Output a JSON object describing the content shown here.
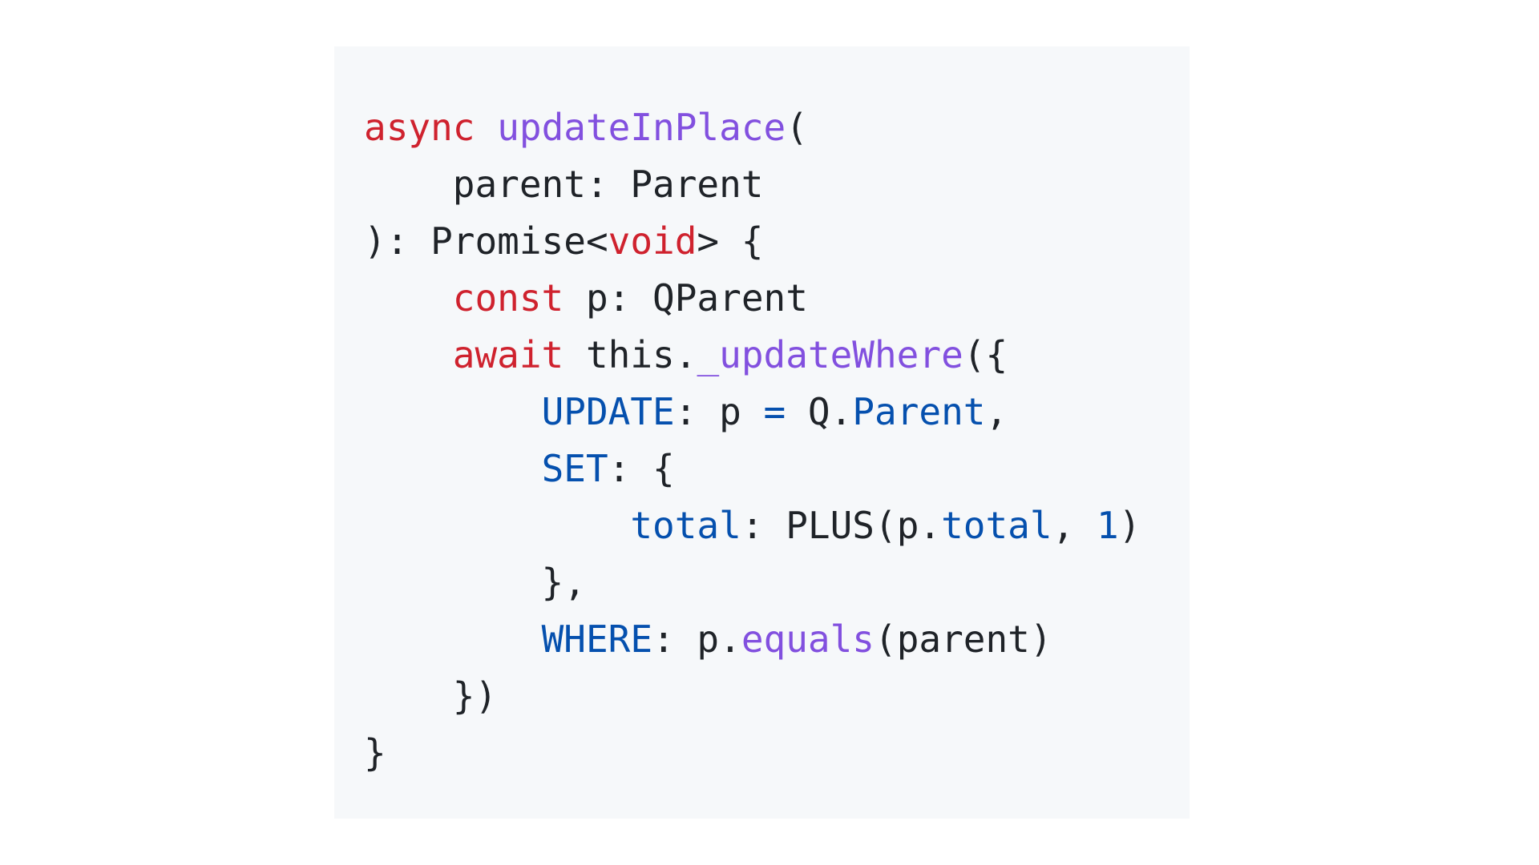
{
  "colors": {
    "background": "#ffffff",
    "code_background": "#f6f8fa",
    "plain": "#1f2328",
    "keyword": "#cf222e",
    "function": "#8250df",
    "property": "#0550ae"
  },
  "code_lines": [
    [
      {
        "text": "async",
        "kind": "kw"
      },
      {
        "text": " ",
        "kind": "pl"
      },
      {
        "text": "updateInPlace",
        "kind": "fn"
      },
      {
        "text": "(",
        "kind": "pl"
      }
    ],
    [
      {
        "text": "    parent: Parent",
        "kind": "pl"
      }
    ],
    [
      {
        "text": "): Promise<",
        "kind": "pl"
      },
      {
        "text": "void",
        "kind": "kw"
      },
      {
        "text": "> {",
        "kind": "pl"
      }
    ],
    [
      {
        "text": "    ",
        "kind": "pl"
      },
      {
        "text": "const",
        "kind": "kw"
      },
      {
        "text": " p: QParent",
        "kind": "pl"
      }
    ],
    [
      {
        "text": "    ",
        "kind": "pl"
      },
      {
        "text": "await",
        "kind": "kw"
      },
      {
        "text": " this.",
        "kind": "pl"
      },
      {
        "text": "_updateWhere",
        "kind": "fn"
      },
      {
        "text": "({",
        "kind": "pl"
      }
    ],
    [
      {
        "text": "        ",
        "kind": "pl"
      },
      {
        "text": "UPDATE",
        "kind": "pr"
      },
      {
        "text": ": p ",
        "kind": "pl"
      },
      {
        "text": "=",
        "kind": "pr"
      },
      {
        "text": " Q.",
        "kind": "pl"
      },
      {
        "text": "Parent",
        "kind": "pr"
      },
      {
        "text": ",",
        "kind": "pl"
      }
    ],
    [
      {
        "text": "        ",
        "kind": "pl"
      },
      {
        "text": "SET",
        "kind": "pr"
      },
      {
        "text": ": {",
        "kind": "pl"
      }
    ],
    [
      {
        "text": "            ",
        "kind": "pl"
      },
      {
        "text": "total",
        "kind": "pr"
      },
      {
        "text": ": PLUS(p.",
        "kind": "pl"
      },
      {
        "text": "total",
        "kind": "pr"
      },
      {
        "text": ", ",
        "kind": "pl"
      },
      {
        "text": "1",
        "kind": "pr"
      },
      {
        "text": ")",
        "kind": "pl"
      }
    ],
    [
      {
        "text": "        },",
        "kind": "pl"
      }
    ],
    [
      {
        "text": "        ",
        "kind": "pl"
      },
      {
        "text": "WHERE",
        "kind": "pr"
      },
      {
        "text": ": p.",
        "kind": "pl"
      },
      {
        "text": "equals",
        "kind": "fn"
      },
      {
        "text": "(parent)",
        "kind": "pl"
      }
    ],
    [
      {
        "text": "    })",
        "kind": "pl"
      }
    ],
    [
      {
        "text": "}",
        "kind": "pl"
      }
    ]
  ]
}
